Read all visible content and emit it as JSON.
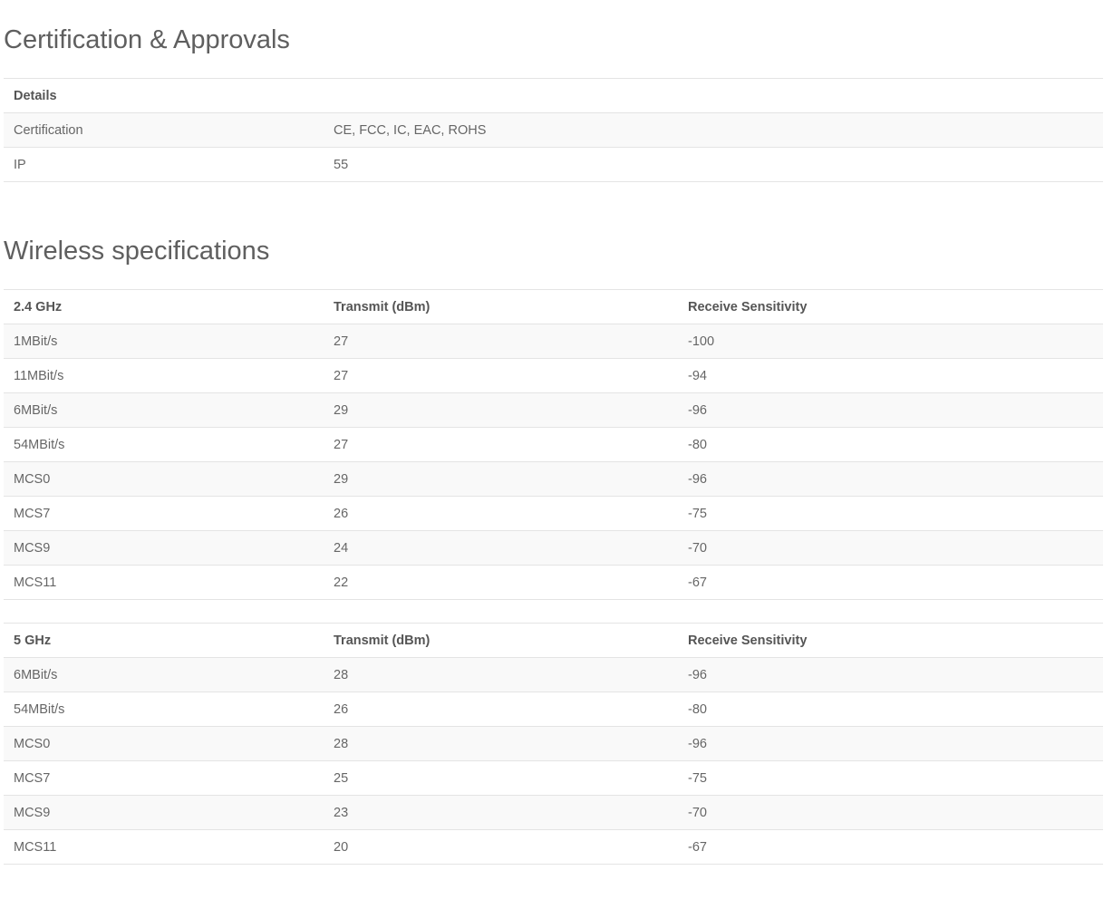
{
  "certification": {
    "title": "Certification & Approvals",
    "header": "Details",
    "rows": [
      {
        "label": "Certification",
        "value": "CE, FCC, IC, EAC, ROHS"
      },
      {
        "label": "IP",
        "value": "55"
      }
    ]
  },
  "wireless": {
    "title": "Wireless specifications",
    "band_24": {
      "headers": [
        "2.4 GHz",
        "Transmit (dBm)",
        "Receive Sensitivity"
      ],
      "rows": [
        {
          "rate": "1MBit/s",
          "transmit": "27",
          "sensitivity": "-100"
        },
        {
          "rate": "11MBit/s",
          "transmit": "27",
          "sensitivity": "-94"
        },
        {
          "rate": "6MBit/s",
          "transmit": "29",
          "sensitivity": "-96"
        },
        {
          "rate": "54MBit/s",
          "transmit": "27",
          "sensitivity": "-80"
        },
        {
          "rate": "MCS0",
          "transmit": "29",
          "sensitivity": "-96"
        },
        {
          "rate": "MCS7",
          "transmit": "26",
          "sensitivity": "-75"
        },
        {
          "rate": "MCS9",
          "transmit": "24",
          "sensitivity": "-70"
        },
        {
          "rate": "MCS11",
          "transmit": "22",
          "sensitivity": "-67"
        }
      ]
    },
    "band_5": {
      "headers": [
        "5 GHz",
        "Transmit (dBm)",
        "Receive Sensitivity"
      ],
      "rows": [
        {
          "rate": "6MBit/s",
          "transmit": "28",
          "sensitivity": "-96"
        },
        {
          "rate": "54MBit/s",
          "transmit": "26",
          "sensitivity": "-80"
        },
        {
          "rate": "MCS0",
          "transmit": "28",
          "sensitivity": "-96"
        },
        {
          "rate": "MCS7",
          "transmit": "25",
          "sensitivity": "-75"
        },
        {
          "rate": "MCS9",
          "transmit": "23",
          "sensitivity": "-70"
        },
        {
          "rate": "MCS11",
          "transmit": "20",
          "sensitivity": "-67"
        }
      ]
    }
  }
}
